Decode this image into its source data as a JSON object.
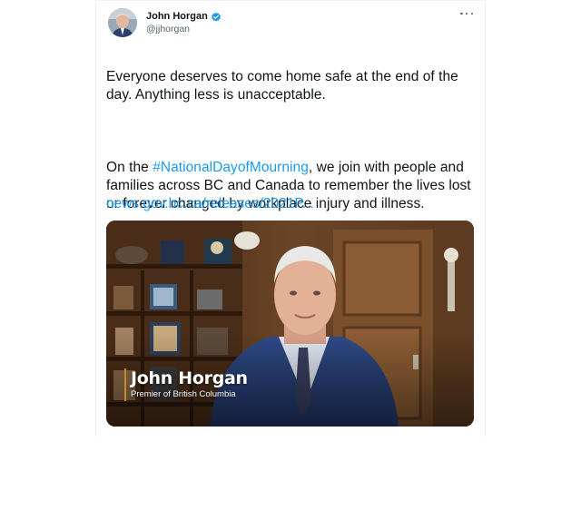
{
  "tweet": {
    "author": {
      "display_name": "John Horgan",
      "handle": "@jjhorgan",
      "verified": true
    },
    "more_icon": "more-horizontal-icon",
    "text": {
      "paragraph1": "Everyone deserves to come home safe at the end of the day. Anything less is unacceptable.",
      "paragraph2_before": "On the ",
      "hashtag": "#NationalDayofMourning",
      "paragraph2_after": ", we join with people and families across BC and Canada to remember the lives lost or forever changed by workplace injury and illness."
    },
    "link": "news.gov.bc.ca/releases/2021P...",
    "media": {
      "lower_third_name": "John Horgan",
      "lower_third_title": "Premier of British Columbia"
    }
  },
  "colors": {
    "link": "#1d9bf0",
    "text": "#0f1419",
    "secondary": "#536471",
    "verified": "#1d9bf0",
    "lower_third_accent": "#c98c1e"
  }
}
